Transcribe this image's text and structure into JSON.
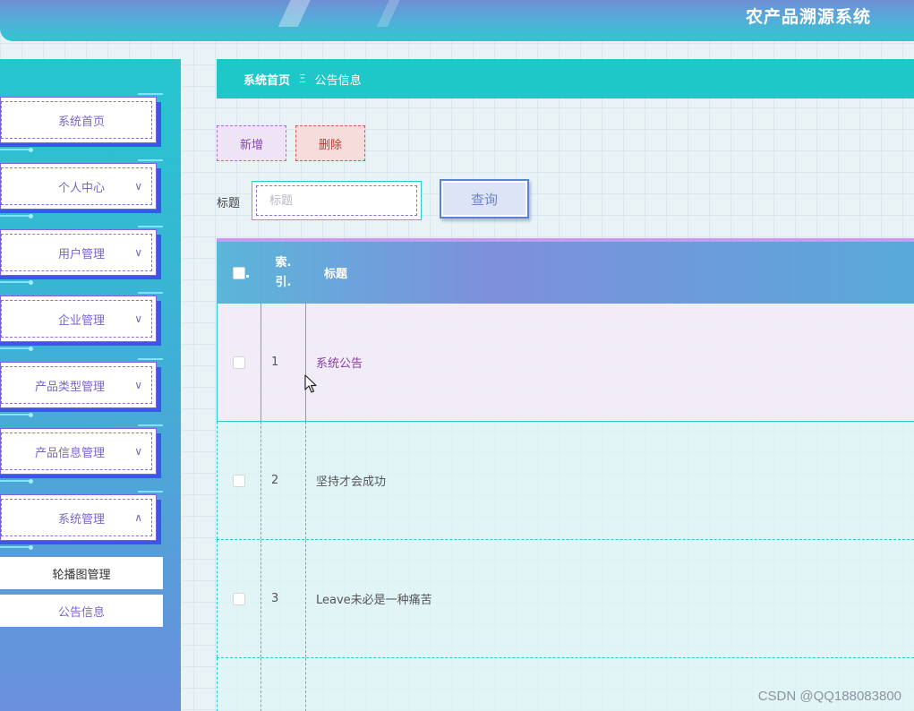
{
  "header": {
    "app_title": "农产品溯源系统"
  },
  "sidebar": {
    "items": [
      {
        "label": "系统首页",
        "chevron": ""
      },
      {
        "label": "个人中心",
        "chevron": "∨"
      },
      {
        "label": "用户管理",
        "chevron": "∨"
      },
      {
        "label": "企业管理",
        "chevron": "∨"
      },
      {
        "label": "产品类型管理",
        "chevron": "∨"
      },
      {
        "label": "产品信息管理",
        "chevron": "∨"
      },
      {
        "label": "系统管理",
        "chevron": "∧"
      }
    ],
    "subitems": [
      {
        "label": "轮播图管理",
        "color": "#333333"
      },
      {
        "label": "公告信息",
        "color": "#7a66c8"
      }
    ]
  },
  "breadcrumb": {
    "home": "系统首页",
    "separator": "Ξ",
    "current": "公告信息"
  },
  "toolbar": {
    "add_label": "新增",
    "delete_label": "删除"
  },
  "search": {
    "label": "标题",
    "placeholder": "标题",
    "value": "",
    "button_label": "查询"
  },
  "table": {
    "headers": {
      "index_line1": "索.",
      "index_line2": "引.",
      "title": "标题"
    },
    "rows": [
      {
        "index": "1",
        "title": "系统公告"
      },
      {
        "index": "2",
        "title": "坚持才会成功"
      },
      {
        "index": "3",
        "title": "Leave未必是一种痛苦"
      }
    ]
  },
  "watermark": "CSDN @QQ188083800",
  "colors": {
    "accent_teal": "#1fc8c8",
    "accent_purple": "#7a66c8",
    "delete_red": "#c0392b"
  }
}
